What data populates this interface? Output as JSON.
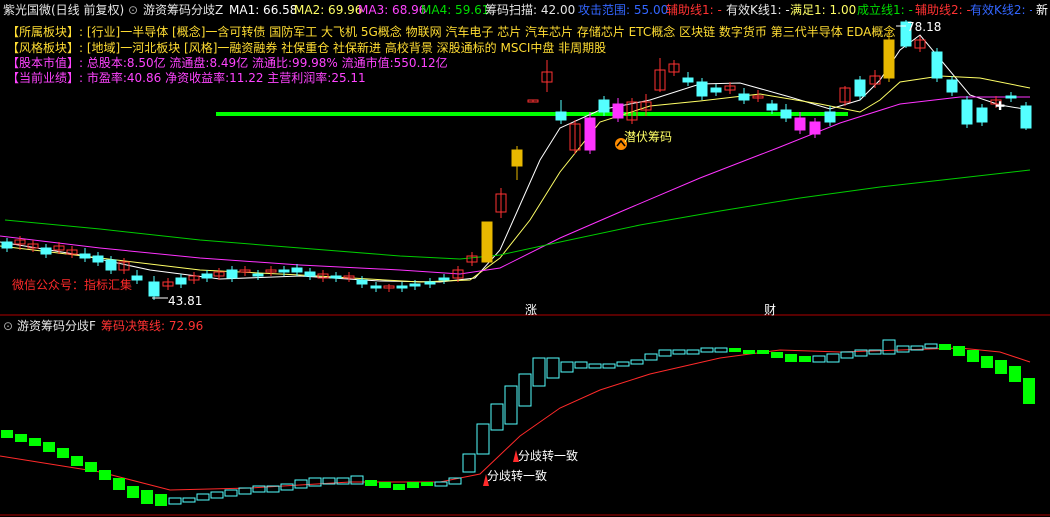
{
  "header": {
    "stock_name": "紫光国微(日线 前复权)",
    "indicator_name": "游资筹码分歧Z",
    "ma1": "MA1: 66.58",
    "ma2": "MA2: 69.96",
    "ma3": "MA3: 68.96",
    "ma4": "MA4: 59.61",
    "scan": "筹码扫描: 42.00",
    "attack_range": "攻击范围: 55.00",
    "aux1": "辅助线1: -",
    "valid_k1": "有效K线1: -",
    "satisfy1": "满足1: 1.00",
    "establish1": "成立线1: -",
    "aux2": "辅助线2: -",
    "valid_k2": "有效K线2: -",
    "more": "新"
  },
  "info": {
    "industry": "【所属板块】: [行业]一半导体 [概念]一含可转债 国防军工 大飞机 5G概念 物联网 汽车电子 芯片 汽车芯片 存储芯片 ETC概念 区块链 数字货币 第三代半导体 EDA概念",
    "style": "【风格板块】: [地域]一河北板块 [风格]一融资融券 社保重仓 社保新进 高校背景 深股通标的 MSCI中盘 非周期股",
    "equity": "【股本市值】: 总股本:8.50亿 流通盘:8.49亿 流通比:99.98% 流通市值:550.12亿",
    "performance": "【当前业绩】: 市盈率:40.86 净资收益率:11.22 主营利润率:25.11"
  },
  "annotations": {
    "price_high": "78.18",
    "price_low": "43.81",
    "wechat": "微信公众号：指标汇集",
    "ambush": "潜伏筹码",
    "limit_up": "涨",
    "finance": "财",
    "diverge1": "分歧转一致",
    "diverge2": "分歧转一致"
  },
  "lower_panel": {
    "title": "游资筹码分歧F",
    "decision_line": "筹码决策线: 72.96"
  },
  "colors": {
    "up": "#ff3232",
    "down": "#54ffff",
    "green_bar": "#00ff00",
    "gold": "#e8b800",
    "ma1": "#ffffff",
    "ma2": "#ffff66",
    "ma3": "#ff33ff",
    "ma4": "#00cc00",
    "level": "#00ff00",
    "magenta_box": "#ff33ff"
  }
}
